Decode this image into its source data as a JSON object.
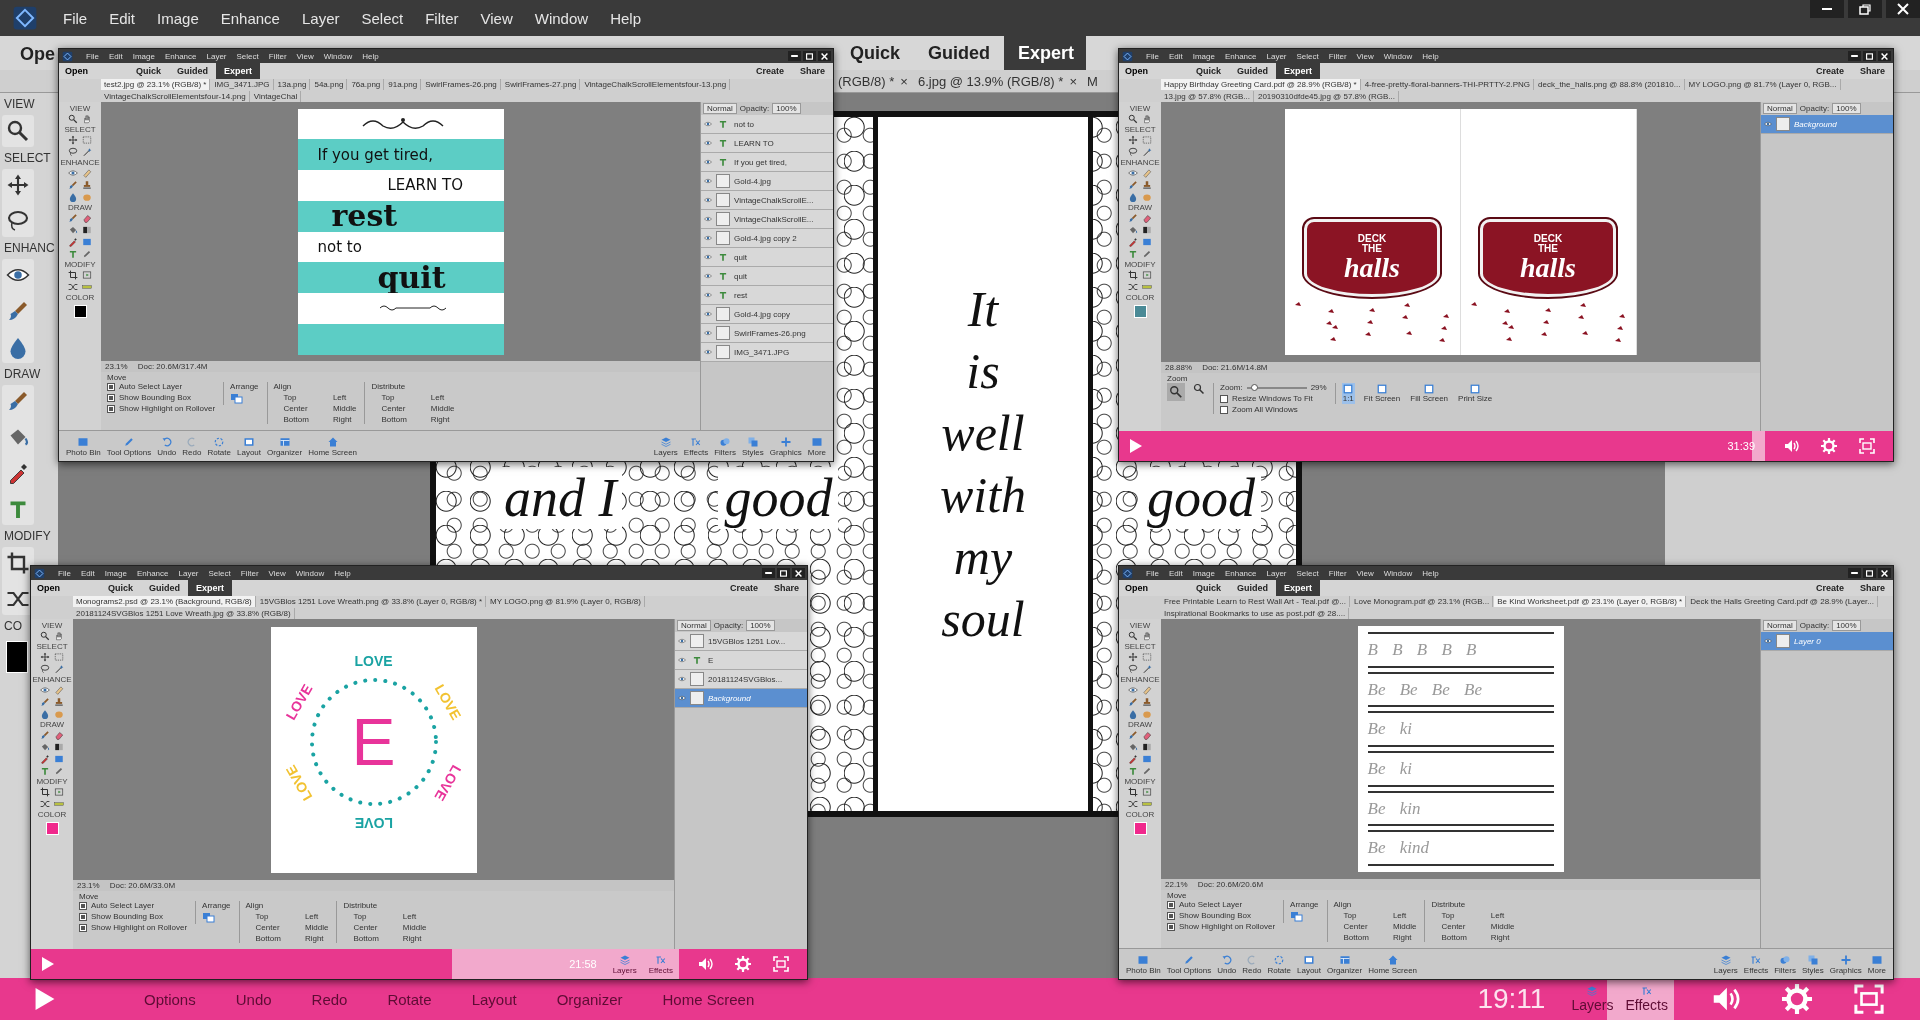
{
  "main": {
    "menu": [
      "File",
      "Edit",
      "Image",
      "Enhance",
      "Layer",
      "Select",
      "Filter",
      "View",
      "Window",
      "Help"
    ],
    "open": "Ope",
    "modes": [
      {
        "label": "Quick",
        "selected": false
      },
      {
        "label": "Guided",
        "selected": false
      },
      {
        "label": "Expert",
        "selected": true
      }
    ],
    "doc_tabs": [
      {
        "label": "(RGB/8) *",
        "close": "×"
      },
      {
        "label": "6.jpg @ 13.9% (RGB/8) *",
        "close": "×"
      },
      {
        "label": "M"
      }
    ],
    "tool_sections": [
      "VIEW",
      "SELECT",
      "ENHANC",
      "DRAW",
      "MODIFY",
      "CO"
    ],
    "swatch": {
      "color": "#000000"
    },
    "artwork": {
      "center": [
        "It",
        "is",
        "well",
        "with",
        "my",
        "soul"
      ],
      "side_left": [
        "and I",
        "good"
      ],
      "side_right": [
        "good"
      ]
    },
    "player": {
      "time": "19:11",
      "level": 0.96,
      "faded": [
        "Options",
        "Undo",
        "Redo",
        "Rotate",
        "Layout",
        "Organizer",
        "Home Screen"
      ],
      "right": [
        "Layers",
        "Effects"
      ]
    }
  },
  "windows": [
    {
      "menu": [
        "File",
        "Edit",
        "Image",
        "Enhance",
        "Layer",
        "Select",
        "Filter",
        "View",
        "Window",
        "Help"
      ],
      "open": "Open",
      "modes": [
        {
          "label": "Quick",
          "selected": false
        },
        {
          "label": "Guided",
          "selected": false
        },
        {
          "label": "Expert",
          "selected": true
        }
      ],
      "create": "Create",
      "share": "Share",
      "doc_tabs": [
        {
          "label": "test2.jpg @ 23.1% (RGB/8) *",
          "selected": true
        },
        {
          "label": "IMG_3471.JPG",
          "selected": false
        },
        {
          "label": "13a.png",
          "selected": false
        },
        {
          "label": "54a.png",
          "selected": false
        },
        {
          "label": "76a.png",
          "selected": false
        },
        {
          "label": "91a.png",
          "selected": false
        },
        {
          "label": "SwirlFrames-26.png",
          "selected": false
        },
        {
          "label": "SwirlFrames-27.png",
          "selected": false
        },
        {
          "label": "VintageChalkScrollElementsfour-13.png",
          "selected": false
        },
        {
          "label": "VintageChalkScrollElementsfour-14.png",
          "selected": false
        },
        {
          "label": "VintageChal",
          "selected": false
        }
      ],
      "tool_sections": [
        "VIEW",
        "SELECT",
        "ENHANCE",
        "DRAW",
        "MODIFY",
        "COLOR"
      ],
      "swatch": {
        "color": "#000000"
      },
      "artwork": {
        "kind": "poster",
        "lines": [
          {
            "text": "If you get tired,",
            "kind": "plain"
          },
          {
            "text": "LEARN TO",
            "kind": "plain"
          },
          {
            "text": "rest",
            "kind": "display"
          },
          {
            "text": "not to",
            "kind": "plain"
          },
          {
            "text": "quit",
            "kind": "display"
          }
        ]
      },
      "blend": "Normal",
      "opacity_label": "Opacity:",
      "opacity": "100%",
      "layers": [
        {
          "name": "not to",
          "kind": "text",
          "selected": false
        },
        {
          "name": "LEARN TO",
          "kind": "text",
          "selected": false
        },
        {
          "name": "If you get tired,",
          "kind": "text",
          "selected": false
        },
        {
          "name": "Gold-4.jpg",
          "kind": "image",
          "selected": false
        },
        {
          "name": "VintageChalkScrollE...",
          "kind": "image",
          "selected": false
        },
        {
          "name": "VintageChalkScrollE...",
          "kind": "image",
          "selected": false
        },
        {
          "name": "Gold-4.jpg copy 2",
          "kind": "image",
          "selected": false
        },
        {
          "name": "quit",
          "kind": "text",
          "selected": false
        },
        {
          "name": "quit",
          "kind": "text",
          "selected": false
        },
        {
          "name": "rest",
          "kind": "text",
          "selected": false
        },
        {
          "name": "Gold-4.jpg copy",
          "kind": "image",
          "selected": false
        },
        {
          "name": "SwirlFrames-26.png",
          "kind": "image",
          "selected": false
        },
        {
          "name": "IMG_3471.JPG",
          "kind": "image",
          "selected": false
        }
      ],
      "status": {
        "zoom": "23.1%",
        "doc": "Doc: 20.6M/317.4M"
      },
      "options": {
        "kind": "move",
        "title": "Move",
        "checks": [
          {
            "label": "Auto Select Layer",
            "checked": true
          },
          {
            "label": "Show Bounding Box",
            "checked": true
          },
          {
            "label": "Show Highlight on Rollover",
            "checked": true
          }
        ],
        "arrange": "Arrange",
        "align": "Align",
        "align_items": [
          "Top",
          "Center",
          "Bottom",
          "Left",
          "Middle",
          "Right"
        ],
        "distribute": "Distribute",
        "distribute_items": [
          "Top",
          "Center",
          "Bottom",
          "Left",
          "Middle",
          "Right"
        ]
      },
      "bottom_left": [
        "Photo Bin",
        "Tool Options",
        "Undo",
        "Redo",
        "Rotate",
        "Layout",
        "Organizer",
        "Home Screen"
      ],
      "bottom_right": [
        "Layers",
        "Effects",
        "Filters",
        "Styles",
        "Graphics",
        "More"
      ]
    },
    {
      "menu": [
        "File",
        "Edit",
        "Image",
        "Enhance",
        "Layer",
        "Select",
        "Filter",
        "View",
        "Window",
        "Help"
      ],
      "open": "Open",
      "modes": [
        {
          "label": "Quick",
          "selected": false
        },
        {
          "label": "Guided",
          "selected": false
        },
        {
          "label": "Expert",
          "selected": true
        }
      ],
      "create": "Create",
      "share": "Share",
      "doc_tabs": [
        {
          "label": "Happy Birthday Greeting Card.pdf @ 28.9% (RGB/8) *",
          "selected": true
        },
        {
          "label": "4-free-pretty-floral-banners-THI-PRTTY-2.PNG",
          "selected": false
        },
        {
          "label": "deck_the_halls.png @ 88.8% (201810...",
          "selected": false
        },
        {
          "label": "MY LOGO.png @ 81.7% (Layer 0, RGB...",
          "selected": false
        },
        {
          "label": "13.jpg @ 57.8% (RGB...",
          "selected": false
        },
        {
          "label": "20190310dfde45.jpg @ 57.8% (RGB...",
          "selected": false
        }
      ],
      "tool_sections": [
        "VIEW",
        "SELECT",
        "ENHANCE",
        "DRAW",
        "MODIFY",
        "COLOR"
      ],
      "swatch": {
        "color": "#4a8a96"
      },
      "artwork": {
        "kind": "card",
        "badges": [
          {
            "top": "DECK",
            "middle": "THE",
            "bottom": "halls"
          },
          {
            "top": "DECK",
            "middle": "THE",
            "bottom": "halls"
          }
        ]
      },
      "blend": "Normal",
      "opacity_label": "Opacity:",
      "opacity": "100%",
      "layers": [
        {
          "name": "Background",
          "kind": "image",
          "selected": true
        }
      ],
      "status": {
        "zoom": "28.88%",
        "doc": "Doc: 21.6M/14.8M"
      },
      "options": {
        "kind": "zoom",
        "title": "Zoom",
        "field": "Zoom:",
        "level": 0.12,
        "reading": "29%",
        "checks": [
          {
            "label": "Resize Windows To Fit",
            "checked": false
          },
          {
            "label": "Zoom All Windows",
            "checked": false
          }
        ],
        "buttons": [
          "1:1",
          "Fit Screen",
          "Fill Screen",
          "Print Size"
        ]
      },
      "player": {
        "time": "31:39",
        "level": 0.98
      }
    },
    {
      "menu": [
        "File",
        "Edit",
        "Image",
        "Enhance",
        "Layer",
        "Select",
        "Filter",
        "View",
        "Window",
        "Help"
      ],
      "open": "Open",
      "modes": [
        {
          "label": "Quick",
          "selected": false
        },
        {
          "label": "Guided",
          "selected": false
        },
        {
          "label": "Expert",
          "selected": true
        }
      ],
      "create": "Create",
      "share": "Share",
      "doc_tabs": [
        {
          "label": "Monograms2.psd @ 23.1% (Background, RGB/8)",
          "selected": true
        },
        {
          "label": "15VGBlos 1251 Love Wreath.png @ 33.8% (Layer 0, RGB/8) *",
          "selected": false
        },
        {
          "label": "MY LOGO.png @ 81.9% (Layer 0, RGB/8)",
          "selected": false
        },
        {
          "label": "20181124SVGBlos 1251 Love Wreath.jpg @ 33.8% (RGB/8)",
          "selected": false
        }
      ],
      "tool_sections": [
        "VIEW",
        "SELECT",
        "ENHANCE",
        "DRAW",
        "MODIFY",
        "COLOR"
      ],
      "swatch": {
        "color": "#f0288c"
      },
      "artwork": {
        "kind": "wreath",
        "words": [
          "LOVE",
          "LOVE",
          "LOVE",
          "LOVE",
          "LOVE",
          "LOVE"
        ],
        "letter": "E"
      },
      "blend": "Normal",
      "opacity_label": "Opacity:",
      "opacity": "100%",
      "layers": [
        {
          "name": "15VGBlos 1251 Lov...",
          "kind": "image",
          "selected": false
        },
        {
          "name": "E",
          "kind": "text",
          "selected": false
        },
        {
          "name": "20181124SVGBlos...",
          "kind": "image",
          "selected": false
        },
        {
          "name": "Background",
          "kind": "image",
          "selected": true
        }
      ],
      "status": {
        "zoom": "23.1%",
        "doc": "Doc: 20.6M/33.0M"
      },
      "options": {
        "kind": "move",
        "title": "Move",
        "checks": [
          {
            "label": "Auto Select Layer",
            "checked": true
          },
          {
            "label": "Show Bounding Box",
            "checked": true
          },
          {
            "label": "Show Highlight on Rollover",
            "checked": true
          }
        ],
        "arrange": "Arrange",
        "align": "Align",
        "align_items": [
          "Top",
          "Center",
          "Bottom",
          "Left",
          "Middle",
          "Right"
        ],
        "distribute": "Distribute",
        "distribute_items": [
          "Top",
          "Center",
          "Bottom",
          "Left",
          "Middle",
          "Right"
        ]
      },
      "player": {
        "time": "21:58",
        "level": 0.65,
        "right": [
          "Layers",
          "Effects"
        ]
      }
    },
    {
      "menu": [
        "File",
        "Edit",
        "Image",
        "Enhance",
        "Layer",
        "Select",
        "Filter",
        "View",
        "Window",
        "Help"
      ],
      "open": "Open",
      "modes": [
        {
          "label": "Quick",
          "selected": false
        },
        {
          "label": "Guided",
          "selected": false
        },
        {
          "label": "Expert",
          "selected": true
        }
      ],
      "create": "Create",
      "share": "Share",
      "doc_tabs": [
        {
          "label": "Free Printable Learn to Rest Wall Art - Teal.pdf @...",
          "selected": false
        },
        {
          "label": "Love Monogram.pdf @ 23.1% (RGB...",
          "selected": false
        },
        {
          "label": "Be Kind Worksheet.pdf @ 23.1% (Layer 0, RGB/8) *",
          "selected": true
        },
        {
          "label": "Deck the Halls Greeting Card.pdf @ 28.9% (Layer...",
          "selected": false
        },
        {
          "label": "Inspirational Bookmarks to use as post.pdf @ 28....",
          "selected": false
        }
      ],
      "tool_sections": [
        "VIEW",
        "SELECT",
        "ENHANCE",
        "DRAW",
        "MODIFY",
        "COLOR"
      ],
      "swatch": {
        "color": "#f0288c"
      },
      "artwork": {
        "kind": "worksheet",
        "rows": [
          "B B B B B",
          "Be Be Be Be",
          "Be ki",
          "Be ki",
          "Be kin",
          "Be kind"
        ]
      },
      "blend": "Normal",
      "opacity_label": "Opacity:",
      "opacity": "100%",
      "layers": [
        {
          "name": "Layer 0",
          "kind": "image",
          "selected": true
        }
      ],
      "status": {
        "zoom": "22.1%",
        "doc": "Doc: 20.6M/20.6M"
      },
      "options": {
        "kind": "move",
        "title": "Move",
        "checks": [
          {
            "label": "Auto Select Layer",
            "checked": true
          },
          {
            "label": "Show Bounding Box",
            "checked": true
          },
          {
            "label": "Show Highlight on Rollover",
            "checked": true
          }
        ],
        "arrange": "Arrange",
        "align": "Align",
        "align_items": [
          "Top",
          "Center",
          "Bottom",
          "Left",
          "Middle",
          "Right"
        ],
        "distribute": "Distribute",
        "distribute_items": [
          "Top",
          "Center",
          "Bottom",
          "Left",
          "Middle",
          "Right"
        ]
      },
      "bottom_left": [
        "Photo Bin",
        "Tool Options",
        "Undo",
        "Redo",
        "Rotate",
        "Layout",
        "Organizer",
        "Home Screen"
      ],
      "bottom_right": [
        "Layers",
        "Effects",
        "Filters",
        "Styles",
        "Graphics",
        "More"
      ]
    }
  ]
}
